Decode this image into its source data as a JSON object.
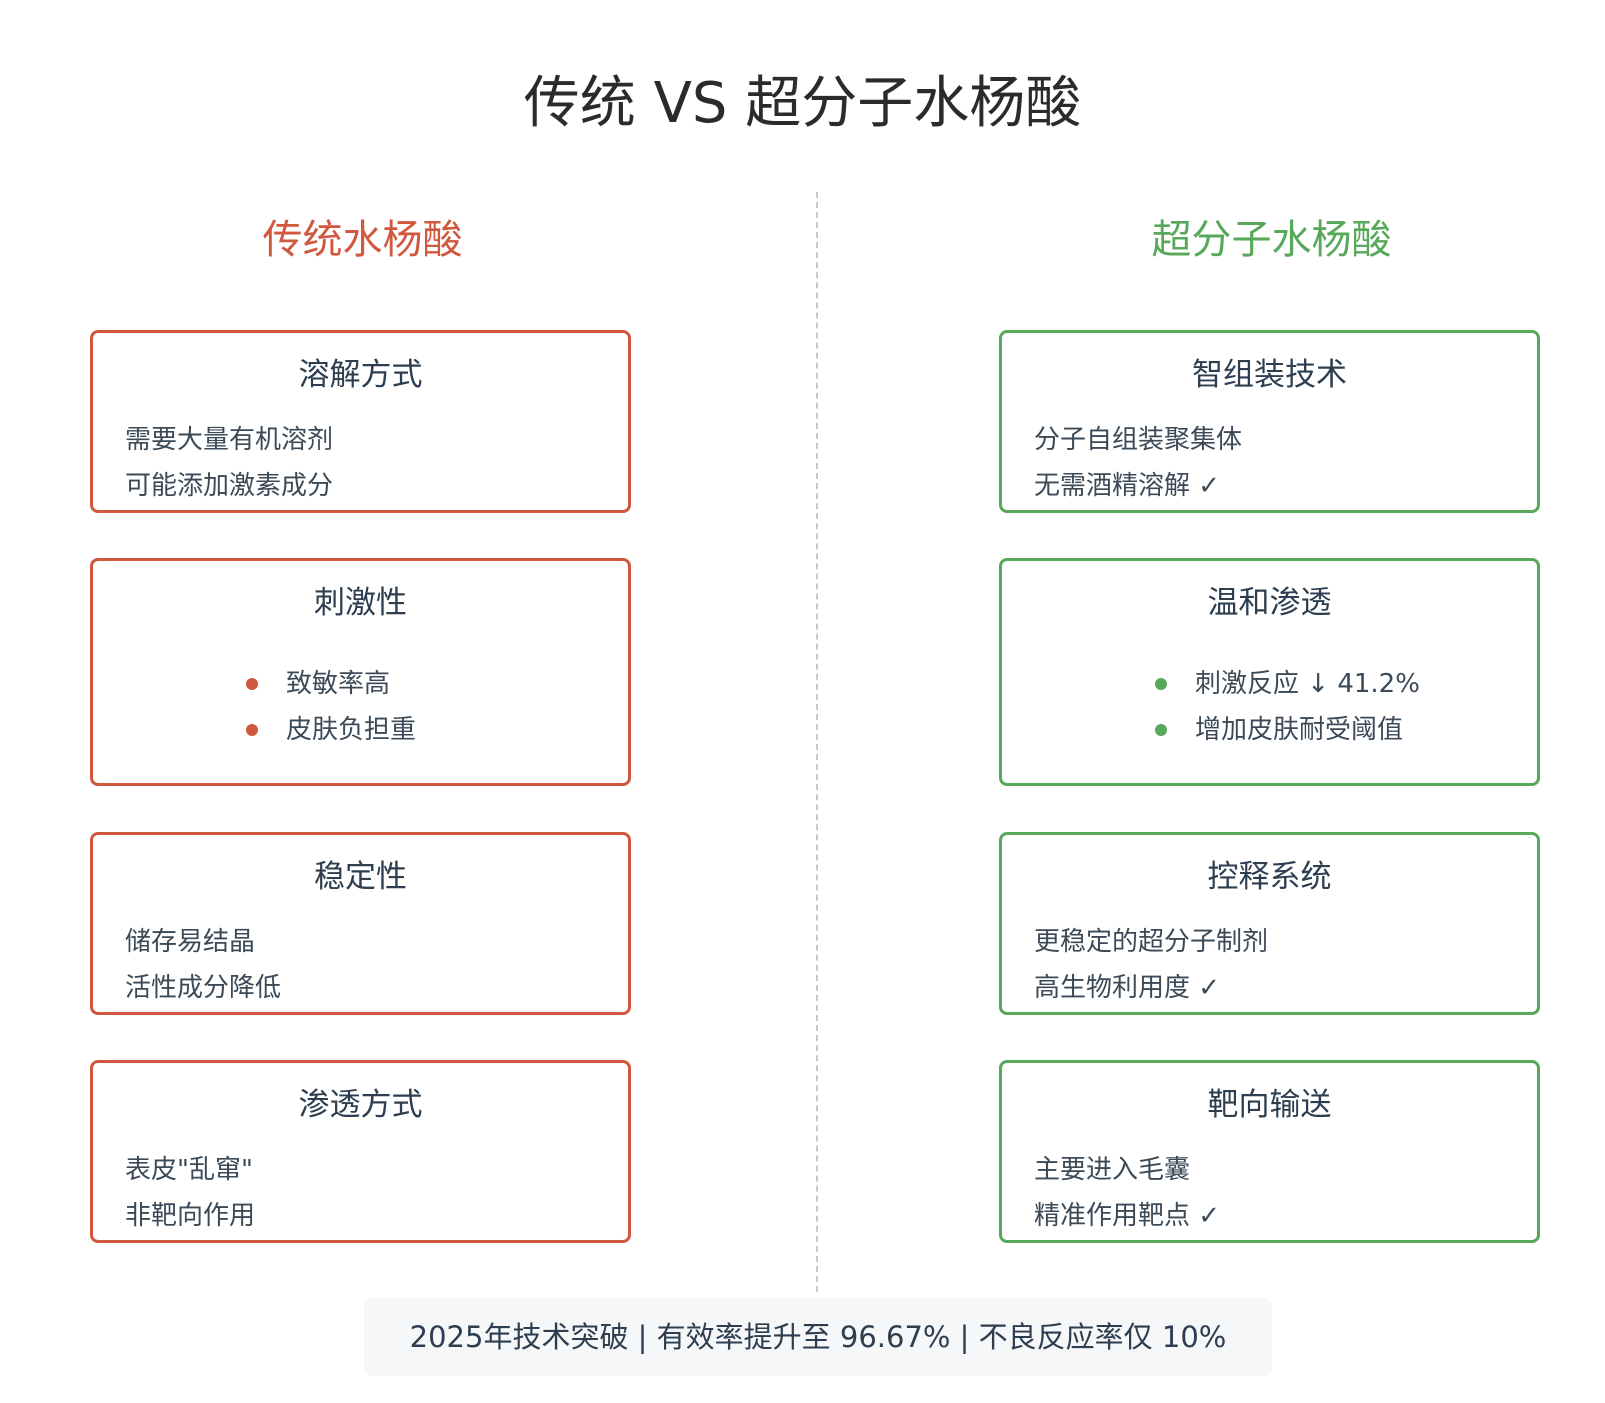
{
  "title": "传统 VS 超分子水杨酸",
  "left": {
    "heading": "传统水杨酸",
    "cards": [
      {
        "title": "溶解方式",
        "lines": [
          "需要大量有机溶剂",
          "可能添加激素成分"
        ]
      },
      {
        "title": "刺激性",
        "bullets": [
          "致敏率高",
          "皮肤负担重"
        ]
      },
      {
        "title": "稳定性",
        "lines": [
          "储存易结晶",
          "活性成分降低"
        ]
      },
      {
        "title": "渗透方式",
        "lines": [
          "表皮\"乱窜\"",
          "非靶向作用"
        ]
      }
    ]
  },
  "right": {
    "heading": "超分子水杨酸",
    "cards": [
      {
        "title": "智组装技术",
        "lines": [
          "分子自组装聚集体",
          "无需酒精溶解 ✓"
        ]
      },
      {
        "title": "温和渗透",
        "bullets": [
          "刺激反应 ↓ 41.2%",
          "增加皮肤耐受阈值"
        ]
      },
      {
        "title": "控释系统",
        "lines": [
          "更稳定的超分子制剂",
          "高生物利用度 ✓"
        ]
      },
      {
        "title": "靶向输送",
        "lines": [
          "主要进入毛囊",
          "精准作用靶点 ✓"
        ]
      }
    ]
  },
  "footer": "2025年技术突破 | 有效率提升至 96.67% | 不良反应率仅 10%",
  "colors": {
    "traditional": "#d0583e",
    "supramolecular": "#57a85a"
  }
}
